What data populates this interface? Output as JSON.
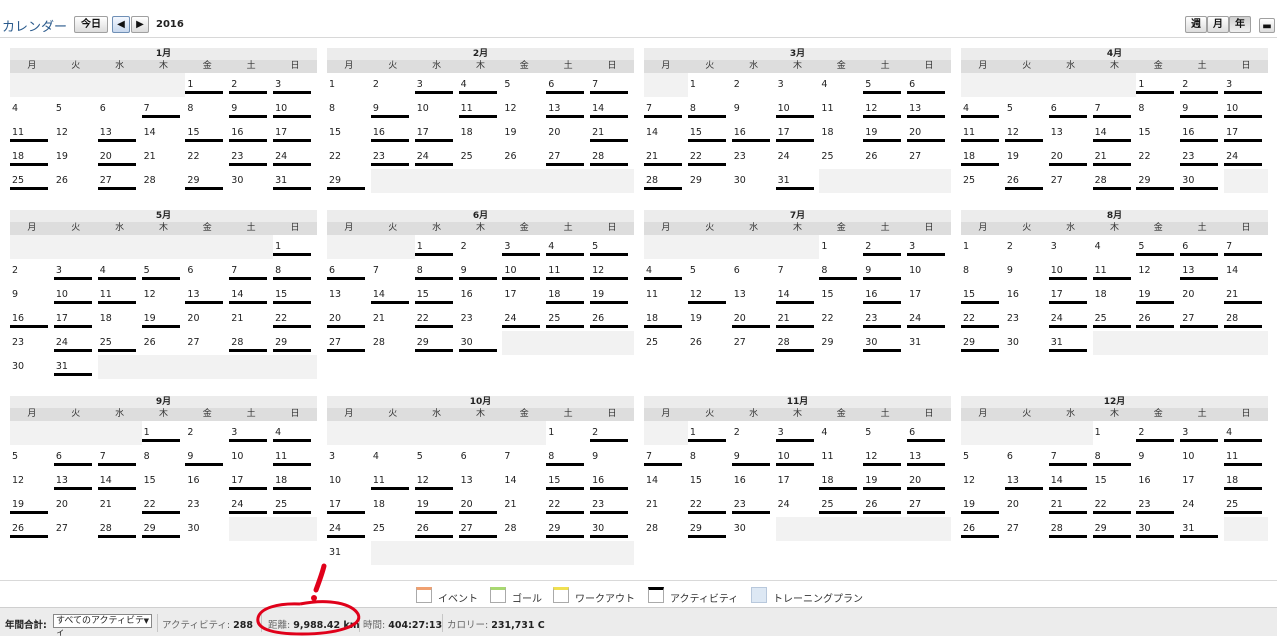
{
  "header": {
    "title": "カレンダー",
    "today_label": "今日",
    "prev_glyph": "◀",
    "next_glyph": "▶",
    "year": "2016",
    "view_week": "週",
    "view_month": "月",
    "view_year": "年",
    "extra_glyph": "▬"
  },
  "weekdays": [
    "月",
    "火",
    "水",
    "木",
    "金",
    "土",
    "日"
  ],
  "months": [
    {
      "title": "1月",
      "start": 4,
      "days": 31,
      "active": [
        1,
        2,
        3,
        7,
        9,
        10,
        11,
        13,
        15,
        16,
        17,
        18,
        20,
        23,
        24,
        25,
        27,
        29,
        31
      ]
    },
    {
      "title": "2月",
      "start": 0,
      "days": 29,
      "active": [
        3,
        4,
        6,
        7,
        9,
        11,
        13,
        14,
        16,
        17,
        21,
        23,
        24,
        27,
        28,
        29
      ]
    },
    {
      "title": "3月",
      "start": 1,
      "days": 31,
      "active": [
        5,
        6,
        7,
        8,
        10,
        12,
        13,
        15,
        16,
        17,
        19,
        20,
        21,
        22,
        28,
        31
      ]
    },
    {
      "title": "4月",
      "start": 4,
      "days": 30,
      "active": [
        1,
        2,
        3,
        4,
        6,
        7,
        9,
        10,
        11,
        12,
        14,
        16,
        17,
        18,
        20,
        21,
        23,
        24,
        26,
        28,
        29,
        30
      ]
    },
    {
      "title": "5月",
      "start": 6,
      "days": 31,
      "active": [
        1,
        3,
        4,
        5,
        7,
        8,
        10,
        11,
        13,
        14,
        15,
        16,
        17,
        19,
        22,
        24,
        25,
        28,
        29,
        31
      ]
    },
    {
      "title": "6月",
      "start": 2,
      "days": 30,
      "active": [
        1,
        3,
        4,
        5,
        6,
        8,
        9,
        10,
        11,
        12,
        14,
        15,
        18,
        19,
        20,
        22,
        24,
        25,
        26,
        27,
        29,
        30
      ]
    },
    {
      "title": "7月",
      "start": 4,
      "days": 31,
      "active": [
        2,
        3,
        4,
        8,
        9,
        12,
        14,
        16,
        18,
        20,
        21,
        23,
        24,
        28,
        30
      ]
    },
    {
      "title": "8月",
      "start": 0,
      "days": 31,
      "active": [
        5,
        6,
        7,
        10,
        11,
        13,
        15,
        17,
        19,
        21,
        22,
        24,
        25,
        26,
        27,
        28,
        29,
        31
      ]
    },
    {
      "title": "9月",
      "start": 3,
      "days": 30,
      "active": [
        1,
        3,
        4,
        6,
        7,
        9,
        11,
        13,
        14,
        17,
        18,
        19,
        22,
        24,
        25,
        26,
        28,
        29
      ]
    },
    {
      "title": "10月",
      "start": 5,
      "days": 31,
      "active": [
        2,
        8,
        11,
        12,
        15,
        16,
        17,
        19,
        20,
        22,
        23,
        24,
        26,
        27,
        29,
        30
      ]
    },
    {
      "title": "11月",
      "start": 1,
      "days": 30,
      "active": [
        1,
        3,
        6,
        7,
        9,
        10,
        12,
        13,
        18,
        19,
        20,
        22,
        23,
        25,
        26,
        27,
        29
      ]
    },
    {
      "title": "12月",
      "start": 3,
      "days": 31,
      "active": [
        2,
        3,
        4,
        7,
        8,
        11,
        13,
        14,
        18,
        19,
        21,
        22,
        23,
        25,
        26,
        28,
        29,
        30,
        31
      ]
    }
  ],
  "legend": [
    {
      "label": "イベント",
      "color": "#f0a070"
    },
    {
      "label": "ゴール",
      "color": "#a8d870"
    },
    {
      "label": "ワークアウト",
      "color": "#f0e050"
    },
    {
      "label": "アクティビティ",
      "color": "#000000"
    },
    {
      "label": "トレーニングプラン",
      "color": "#dde8f4"
    }
  ],
  "footer": {
    "total_label": "年間合計:",
    "select_value": "すべてのアクティビティ",
    "activities_label": "アクティビティ:",
    "activities_value": "288",
    "distance_label": "距離:",
    "distance_value": "9,988.42 km",
    "time_label": "時間:",
    "time_value": "404:27:13",
    "calories_label": "カロリー:",
    "calories_value": "231,731 C"
  },
  "annotation": {
    "mark": "!",
    "color": "#e0001a"
  }
}
